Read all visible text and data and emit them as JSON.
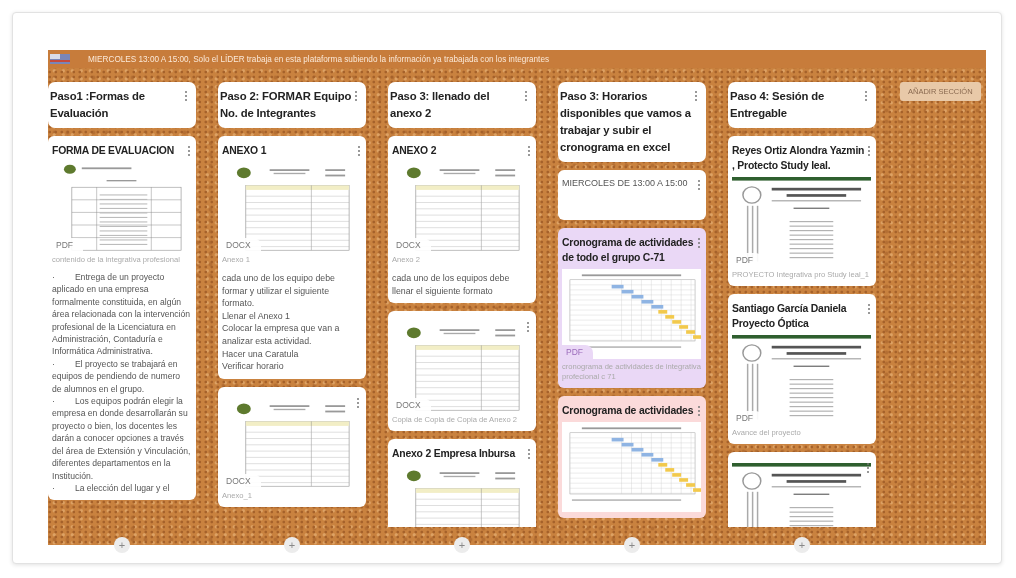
{
  "board": {
    "header_text": "MIERCOLES 13:00 A 15:00, Solo el LÍDER trabaja en esta plataforma subiendo la información ya trabajada con los integrantes",
    "add_section_button": "AÑADIR SECCIÓN",
    "sections": [
      {
        "title": "Paso1 :Formas de Evaluación",
        "add_label": "+",
        "posts": [
          {
            "title": "FORMA DE EVALUACION",
            "color": "#ffffff",
            "attachment": {
              "kind": "table",
              "type": "PDF"
            },
            "caption": "contenido de la integrativa profesional",
            "paragraphs": [
              {
                "bullet": "·",
                "text": "Entrega de un proyecto aplicado en una empresa formalmente constituida, en algún área relacionada con la intervención profesional de la Licenciatura en Administración, Contaduría e Informática Administrativa."
              },
              {
                "bullet": "·",
                "text": "El proyecto se trabajará en equipos de pendiendo de numero de alumnos en el grupo."
              },
              {
                "bullet": "·",
                "text": "Los equipos podrán elegir la empresa en donde desarrollarán su proyecto o bien, los docentes les darán a conocer opciones a través del área de Extensión y Vinculación, diferentes departamentos en la Institución."
              },
              {
                "bullet": "·",
                "text": "La elección del lugar y el"
              }
            ]
          }
        ]
      },
      {
        "title": "Paso 2: FORMAR Equipo No. de Integrantes",
        "add_label": "+",
        "posts": [
          {
            "title": "ANEXO 1",
            "color": "#ffffff",
            "attachment": {
              "kind": "form",
              "type": "DOCX"
            },
            "caption": "Anexo 1",
            "lines": [
              "cada uno de los equipo debe formar y utilizar el siguiente formato.",
              "Llenar el Anexo 1",
              "Colocar la empresa que van a analizar esta actividad.",
              "Hacer una Caratula",
              "Verificar horario"
            ]
          },
          {
            "color": "#ffffff",
            "attachment": {
              "kind": "form",
              "type": "DOCX"
            },
            "caption": "Anexo_1"
          }
        ]
      },
      {
        "title": "Paso 3: llenado del anexo 2",
        "add_label": "+",
        "posts": [
          {
            "title": "ANEXO 2",
            "color": "#ffffff",
            "attachment": {
              "kind": "form",
              "type": "DOCX"
            },
            "caption": "Anexo 2",
            "lines": [
              "cada uno de los equipos debe llenar el siguiente formato"
            ]
          },
          {
            "color": "#ffffff",
            "attachment": {
              "kind": "form",
              "type": "DOCX"
            },
            "caption": "Copia de Copia de Copia de Anexo 2"
          },
          {
            "title": "Anexo 2 Empresa Inbursa",
            "color": "#ffffff",
            "attachment": {
              "kind": "form"
            }
          }
        ]
      },
      {
        "title": "Paso 3: Horarios disponibles que vamos a trabajar y subir el cronograma en excel",
        "add_label": "+",
        "posts": [
          {
            "color": "#ffffff",
            "lines": [
              "MIERCOLES DE 13:00 A 15:00"
            ]
          },
          {
            "title": "Cronograma de actividades de todo el grupo C-71",
            "color": "#ead8f6",
            "attachment": {
              "kind": "gantt",
              "type": "PDF"
            },
            "caption": "cronograma de actividades de integrativa profecional c 71"
          },
          {
            "title": "Cronograma de actividades",
            "color": "#fbdada",
            "attachment": {
              "kind": "gantt"
            }
          }
        ]
      },
      {
        "title": "Paso 4: Sesión de Entregable",
        "add_label": "+",
        "posts": [
          {
            "title": "Reyes Ortiz Alondra Yazmin , Protecto Study leal.",
            "color": "#ffffff",
            "attachment": {
              "kind": "cover",
              "type": "PDF"
            },
            "caption": "PROYECTO Integrativa pro Study leal_1"
          },
          {
            "title": "Santiago García Daniela Proyecto Óptica",
            "color": "#ffffff",
            "attachment": {
              "kind": "cover",
              "type": "PDF"
            },
            "caption": "Avance del proyecto"
          },
          {
            "color": "#ffffff",
            "attachment": {
              "kind": "cover"
            }
          }
        ]
      }
    ]
  }
}
